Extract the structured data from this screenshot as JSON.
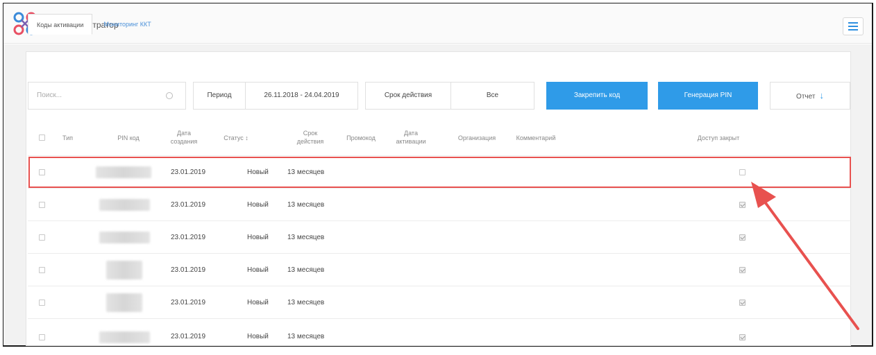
{
  "app": {
    "title": "Web - Регистратор",
    "accent": "#2f9be8",
    "highlight_color": "#e8514f"
  },
  "tabs": [
    {
      "label": "Коды активации",
      "active": true
    },
    {
      "label": "Мониторинг ККТ",
      "active": false
    }
  ],
  "toolbar": {
    "search_placeholder": "Поиск...",
    "period_label": "Период",
    "period_value": "26.11.2018 - 24.04.2019",
    "term_label": "Срок действия",
    "term_value": "Все",
    "lock_button": "Закрепить код",
    "pin_button": "Генерация PIN",
    "report_button": "Отчет"
  },
  "table": {
    "headers": {
      "type": "Тип",
      "pin": "PIN код",
      "created_1": "Дата",
      "created_2": "создания",
      "status": "Статус ↕",
      "term_1": "Срок",
      "term_2": "действия",
      "promo": "Промокод",
      "activated_1": "Дата",
      "activated_2": "активации",
      "org": "Организация",
      "comment": "Комментарий",
      "closed": "Доступ закрыт"
    },
    "rows": [
      {
        "date": "23.01.2019",
        "status": "Новый",
        "term": "13 месяцев",
        "access_closed": false,
        "highlighted": true
      },
      {
        "date": "23.01.2019",
        "status": "Новый",
        "term": "13 месяцев",
        "access_closed": true,
        "highlighted": false
      },
      {
        "date": "23.01.2019",
        "status": "Новый",
        "term": "13 месяцев",
        "access_closed": true,
        "highlighted": false
      },
      {
        "date": "23.01.2019",
        "status": "Новый",
        "term": "13 месяцев",
        "access_closed": true,
        "highlighted": false
      },
      {
        "date": "23.01.2019",
        "status": "Новый",
        "term": "13 месяцев",
        "access_closed": true,
        "highlighted": false
      },
      {
        "date": "23.01.2019",
        "status": "Новый",
        "term": "13 месяцев",
        "access_closed": true,
        "highlighted": false
      }
    ]
  }
}
